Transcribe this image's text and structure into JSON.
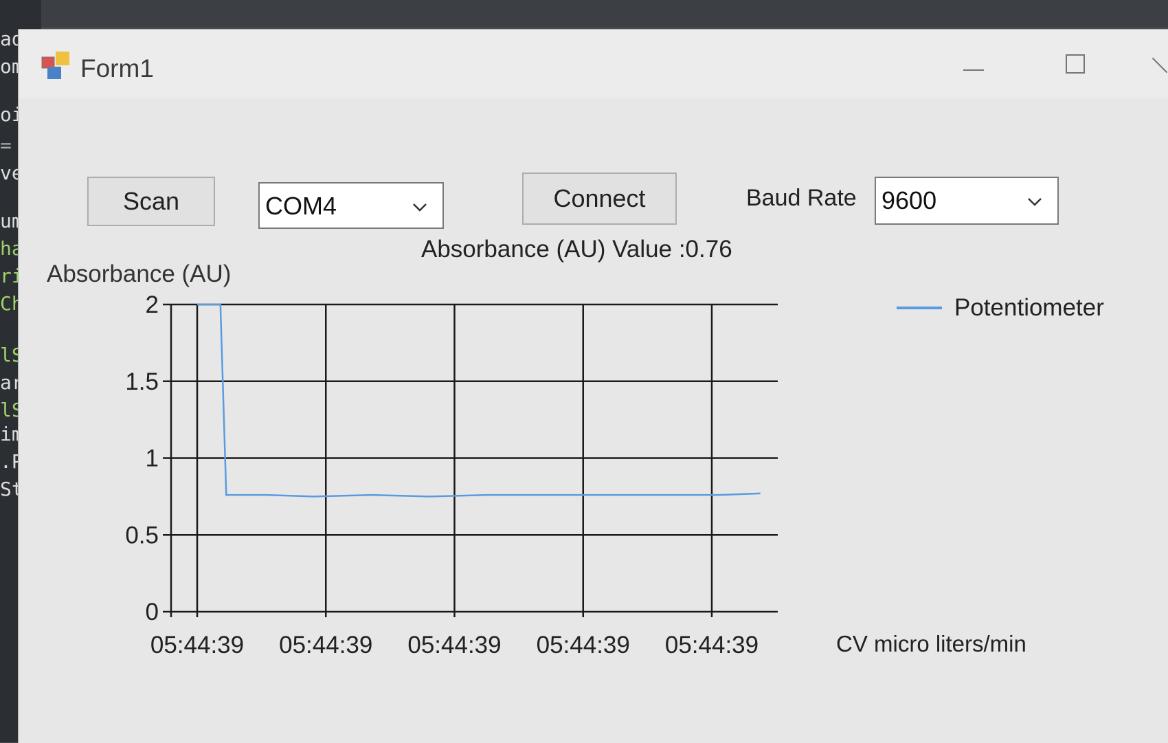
{
  "window": {
    "title": "Form1"
  },
  "controls": {
    "scan_label": "Scan",
    "port_value": "COM4",
    "connect_label": "Connect",
    "baud_label": "Baud Rate",
    "baud_value": "9600",
    "value_text": "Absorbance (AU)  Value :0.76"
  },
  "background_editor": {
    "lines": [
      "ad",
      "om",
      "oi",
      "=",
      "ve",
      "um",
      "ha",
      "ri",
      "Ch",
      "lS",
      "ar",
      "lS",
      "im",
      ".P",
      "St"
    ]
  },
  "colors": {
    "series": "#5a9be0",
    "grid": "#1a1a1a"
  },
  "chart_data": {
    "type": "line",
    "ylabel": "Absorbance (AU)",
    "xlabel": "CV micro liters/min",
    "ylim": [
      0,
      2
    ],
    "yticks": [
      "0",
      "0.5",
      "1",
      "1.5",
      "2"
    ],
    "x_tick_labels": [
      "05:44:39",
      "05:44:39",
      "05:44:39",
      "05:44:39",
      "05:44:39"
    ],
    "grid": true,
    "legend_position": "top-right",
    "series": [
      {
        "name": "Potentiometer",
        "x": [
          0.0,
          0.04,
          0.05,
          0.12,
          0.2,
          0.3,
          0.4,
          0.5,
          0.6,
          0.7,
          0.8,
          0.9,
          0.97
        ],
        "values": [
          2.0,
          2.0,
          0.76,
          0.76,
          0.75,
          0.76,
          0.75,
          0.76,
          0.76,
          0.76,
          0.76,
          0.76,
          0.77
        ]
      }
    ]
  }
}
